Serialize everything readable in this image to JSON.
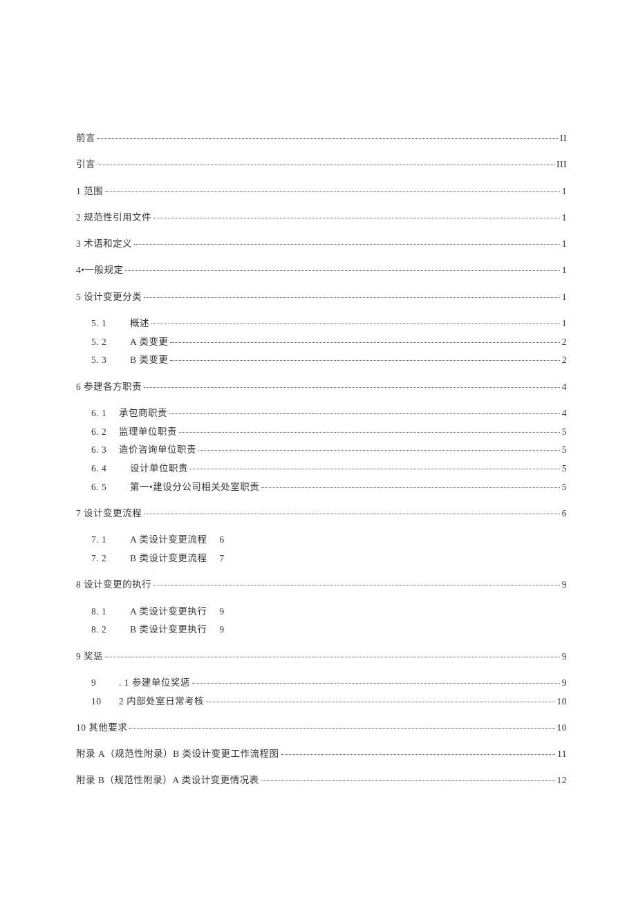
{
  "toc": {
    "preface": {
      "label": "前言",
      "page": "II"
    },
    "intro": {
      "label": "引言",
      "page": "III"
    },
    "s1": {
      "label": "1 范围",
      "page": "1"
    },
    "s2": {
      "label": "2 规范性引用文件",
      "page": "1"
    },
    "s3": {
      "label": "3 术语和定义",
      "page": "1"
    },
    "s4": {
      "label": "4•一般规定",
      "page": "1"
    },
    "s5": {
      "label": "5 设计变更分类",
      "page": "1"
    },
    "s5_1": {
      "num": "5. 1",
      "label": "概述",
      "page": "1"
    },
    "s5_2": {
      "num": "5. 2",
      "label": "A 类变更",
      "page": "2"
    },
    "s5_3": {
      "num": "5. 3",
      "label": "B 类变更",
      "page": "2"
    },
    "s6": {
      "label": "6 参建各方职责",
      "page": "4"
    },
    "s6_1": {
      "num": "6. 1",
      "label": "承包商职责",
      "page": "4"
    },
    "s6_2": {
      "num": "6. 2",
      "label": "监理单位职责",
      "page": "5"
    },
    "s6_3": {
      "num": "6. 3",
      "label": "造价咨询单位职责",
      "page": "5"
    },
    "s6_4": {
      "num": "6. 4",
      "label": "设计单位职责",
      "page": "5"
    },
    "s6_5": {
      "num": "6. 5",
      "label": "第一•建设分公司相关处室职责",
      "page": "5"
    },
    "s7": {
      "label": "7 设计变更流程",
      "page": "6"
    },
    "s7_1": {
      "num": "7. 1",
      "label": "A 类设计变更流程",
      "page": "6"
    },
    "s7_2": {
      "num": "7. 2",
      "label": "B 类设计变更流程",
      "page": "7"
    },
    "s8": {
      "label": "8 设计变更的执行",
      "page": "9"
    },
    "s8_1": {
      "num": "8. 1",
      "label": "A 类设计变更执行",
      "page": "9"
    },
    "s8_2": {
      "num": "8. 2",
      "label": "B 类设计变更执行",
      "page": "9"
    },
    "s9": {
      "label": "9 奖惩",
      "page": "9"
    },
    "s9_1": {
      "num": "9",
      "label": ". 1 参建单位奖惩",
      "page": "9"
    },
    "s9_2": {
      "num": "10",
      "label": "2 内部处室日常考核",
      "page": "10"
    },
    "s10": {
      "label": "10 其他要求",
      "page": "10"
    },
    "appA": {
      "label": "附录 A（规范性附录）B 类设计变更工作流程图",
      "page": "11"
    },
    "appB": {
      "label": "附录 B（规范性附录）A 类设计变更情况表",
      "page": "12"
    }
  }
}
